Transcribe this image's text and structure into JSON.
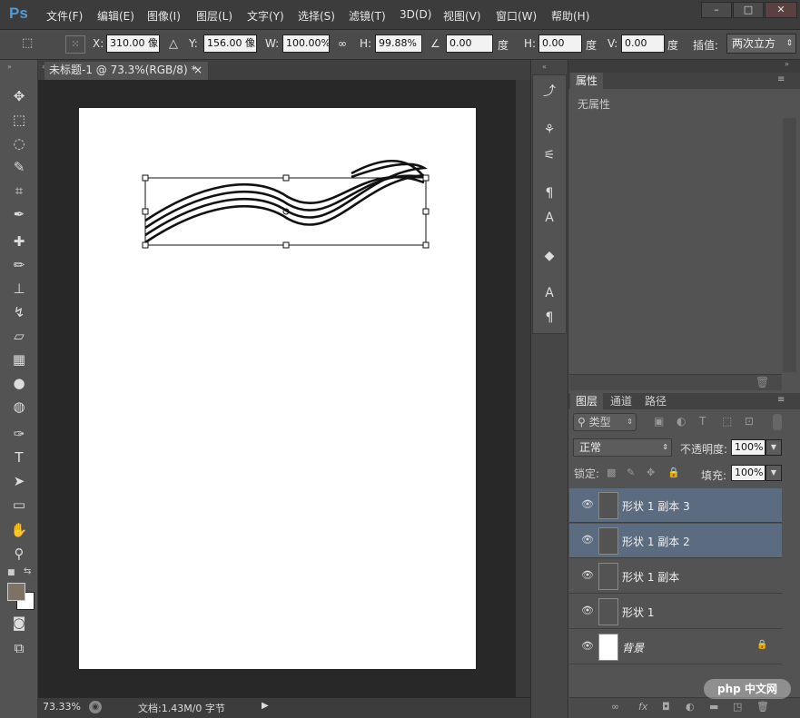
{
  "app": {
    "logo": "Ps"
  },
  "menu": [
    "文件(F)",
    "编辑(E)",
    "图像(I)",
    "图层(L)",
    "文字(Y)",
    "选择(S)",
    "滤镜(T)",
    "3D(D)",
    "视图(V)",
    "窗口(W)",
    "帮助(H)"
  ],
  "window_controls": {
    "minimize": "–",
    "maximize": "□",
    "close": "✕"
  },
  "options": {
    "x_label": "X:",
    "x_value": "310.00 像",
    "y_label": "Y:",
    "y_value": "156.00 像",
    "w_label": "W:",
    "w_value": "100.00%",
    "h_label": "H:",
    "h_value": "99.88%",
    "angle_value": "0.00",
    "angle_unit": "度",
    "hskew_label": "H:",
    "hskew_value": "0.00",
    "hskew_unit": "度",
    "vskew_label": "V:",
    "vskew_value": "0.00",
    "vskew_unit": "度",
    "interp_label": "插值:",
    "interp_value": "两次立方"
  },
  "document": {
    "tab_title": "未标题-1 @ 73.3%(RGB/8) *",
    "close": "×"
  },
  "status": {
    "zoom": "73.33%",
    "doc_info": "文档:1.43M/0 字节"
  },
  "properties": {
    "tab": "属性",
    "content": "无属性"
  },
  "layers_panel": {
    "tabs": [
      "图层",
      "通道",
      "路径"
    ],
    "filter_label": "类型",
    "blend_mode": "正常",
    "opacity_label": "不透明度:",
    "opacity_value": "100%",
    "lock_label": "锁定:",
    "fill_label": "填充:",
    "fill_value": "100%",
    "layers": [
      {
        "name": "形状 1 副本 3",
        "selected": true
      },
      {
        "name": "形状 1 副本 2",
        "selected": true
      },
      {
        "name": "形状 1 副本",
        "selected": false
      },
      {
        "name": "形状 1",
        "selected": false
      },
      {
        "name": "背景",
        "selected": false
      }
    ]
  },
  "watermark": "php 中文网"
}
